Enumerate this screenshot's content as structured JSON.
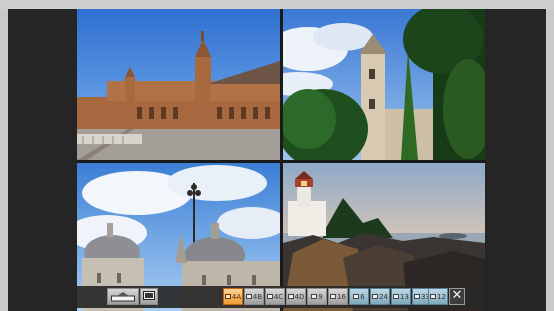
{
  "viewer": {
    "tiles": [
      {
        "subject": "plaza-palace-photo"
      },
      {
        "subject": "church-tower-photo"
      },
      {
        "subject": "domed-cathedral-photo"
      },
      {
        "subject": "lighthouse-photo"
      }
    ]
  },
  "toolbar": {
    "left_buttons": [
      {
        "icon": "slide-layout-icon",
        "label": ""
      },
      {
        "icon": "monitor-icon",
        "label": ""
      }
    ],
    "layout_buttons": [
      {
        "label": "4A",
        "active": true,
        "tint": false
      },
      {
        "label": "4B",
        "active": false,
        "tint": false
      },
      {
        "label": "4C",
        "active": false,
        "tint": false
      },
      {
        "label": "4D",
        "active": false,
        "tint": false
      },
      {
        "label": "9",
        "active": false,
        "tint": false
      },
      {
        "label": "16",
        "active": false,
        "tint": false
      },
      {
        "label": "6",
        "active": false,
        "tint": true
      },
      {
        "label": "24",
        "active": false,
        "tint": true
      },
      {
        "label": "13",
        "active": false,
        "tint": true
      },
      {
        "label": "33",
        "active": false,
        "tint": true
      },
      {
        "label": "12",
        "active": false,
        "tint": true
      }
    ],
    "close_glyph": "✕"
  },
  "colors": {
    "active_button": "#f09a36",
    "frame": "#252525",
    "background": "#c9c9c9"
  }
}
